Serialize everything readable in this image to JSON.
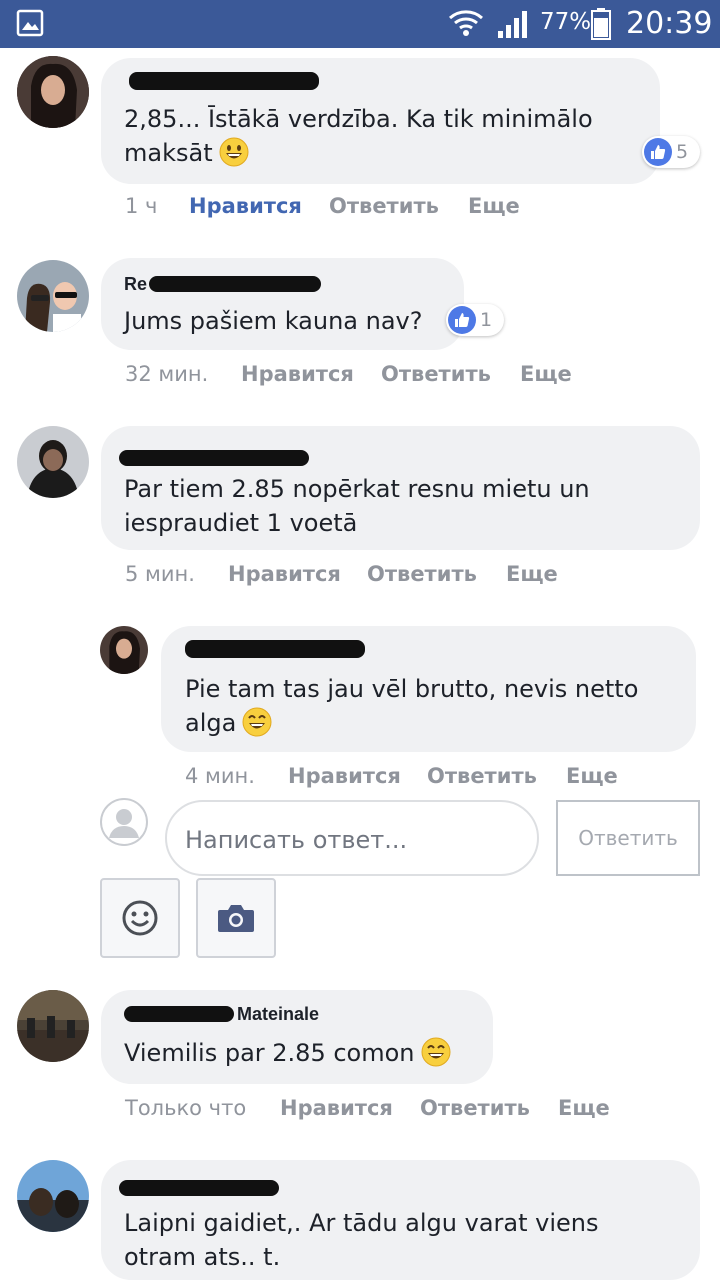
{
  "status_bar": {
    "battery": "77%",
    "time": "20:39"
  },
  "comments": [
    {
      "text": "2,85... Īstākā verdzība. Ka tik minimālo maksāt",
      "emoji": "grinning-face",
      "reactions": "5",
      "time": "1 ч",
      "like": "Нравится",
      "reply": "Ответить",
      "more": "Еще",
      "liked": true
    },
    {
      "name_visible": "Re",
      "text": "Jums pašiem kauna nav?",
      "reactions": "1",
      "time": "32 мин.",
      "like": "Нравится",
      "reply": "Ответить",
      "more": "Еще"
    },
    {
      "text": "Par tiem 2.85 nopērkat resnu mietu un iespraudiet 1 voetā",
      "time": "5 мин.",
      "like": "Нравится",
      "reply": "Ответить",
      "more": "Еще"
    },
    {
      "text": "Pie tam tas jau vēl brutto, nevis netto alga",
      "emoji": "grinning-face-smiling-eyes",
      "time": "4 мин.",
      "like": "Нравится",
      "reply": "Ответить",
      "more": "Еще",
      "is_reply": true
    },
    {
      "name_visible": "Mateinale",
      "text": "Viemilis par 2.85 comon",
      "emoji": "grinning-face-smiling-eyes",
      "time": "Только что",
      "like": "Нравится",
      "reply": "Ответить",
      "more": "Еще"
    },
    {
      "text": "Laipni gaidiet,. Ar tādu algu varat viens otram ats.. t."
    }
  ],
  "reply_box": {
    "placeholder": "Написать ответ...",
    "button": "Ответить",
    "tools": [
      "smiley-icon",
      "camera-icon"
    ]
  },
  "colors": {
    "status_bar": "#3b5998",
    "bubble": "#f0f1f3",
    "link_active": "#4267b2",
    "meta": "#90949c",
    "like_badge": "#4e79e6"
  }
}
